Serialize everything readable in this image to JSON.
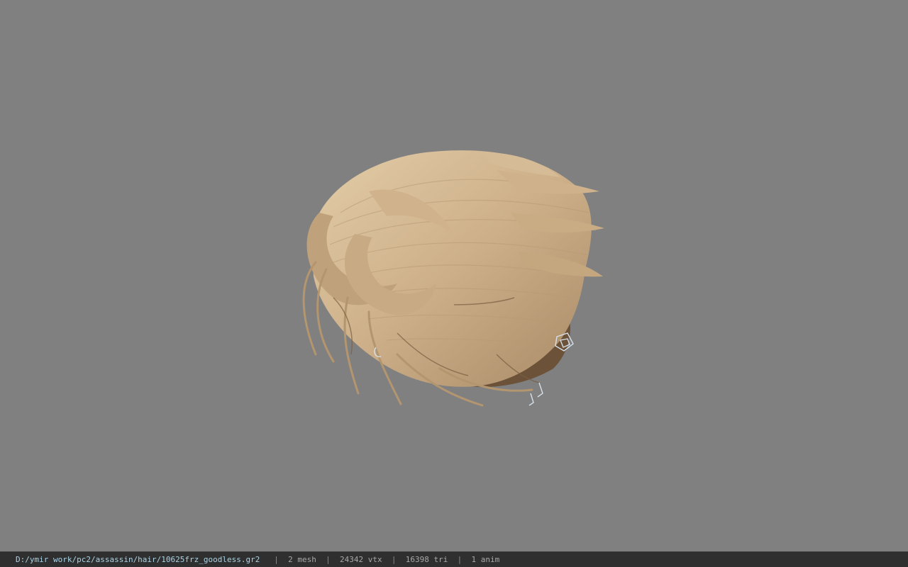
{
  "viewer": {
    "background_color": "#808080",
    "model": {
      "name": "hair-model",
      "hair_base_color": "#cdb08a",
      "hair_shadow_color": "#8a6e4e",
      "hair_highlight_color": "#e6d2b0"
    }
  },
  "status_bar": {
    "file_path": "D:/ymir work/pc2/assassin/hair/10625frz_goodless.gr2",
    "mesh_count": "2 mesh",
    "vertex_count": "24342 vtx",
    "triangle_count": "16398 tri",
    "anim_count": "1 anim",
    "separator": "|"
  }
}
